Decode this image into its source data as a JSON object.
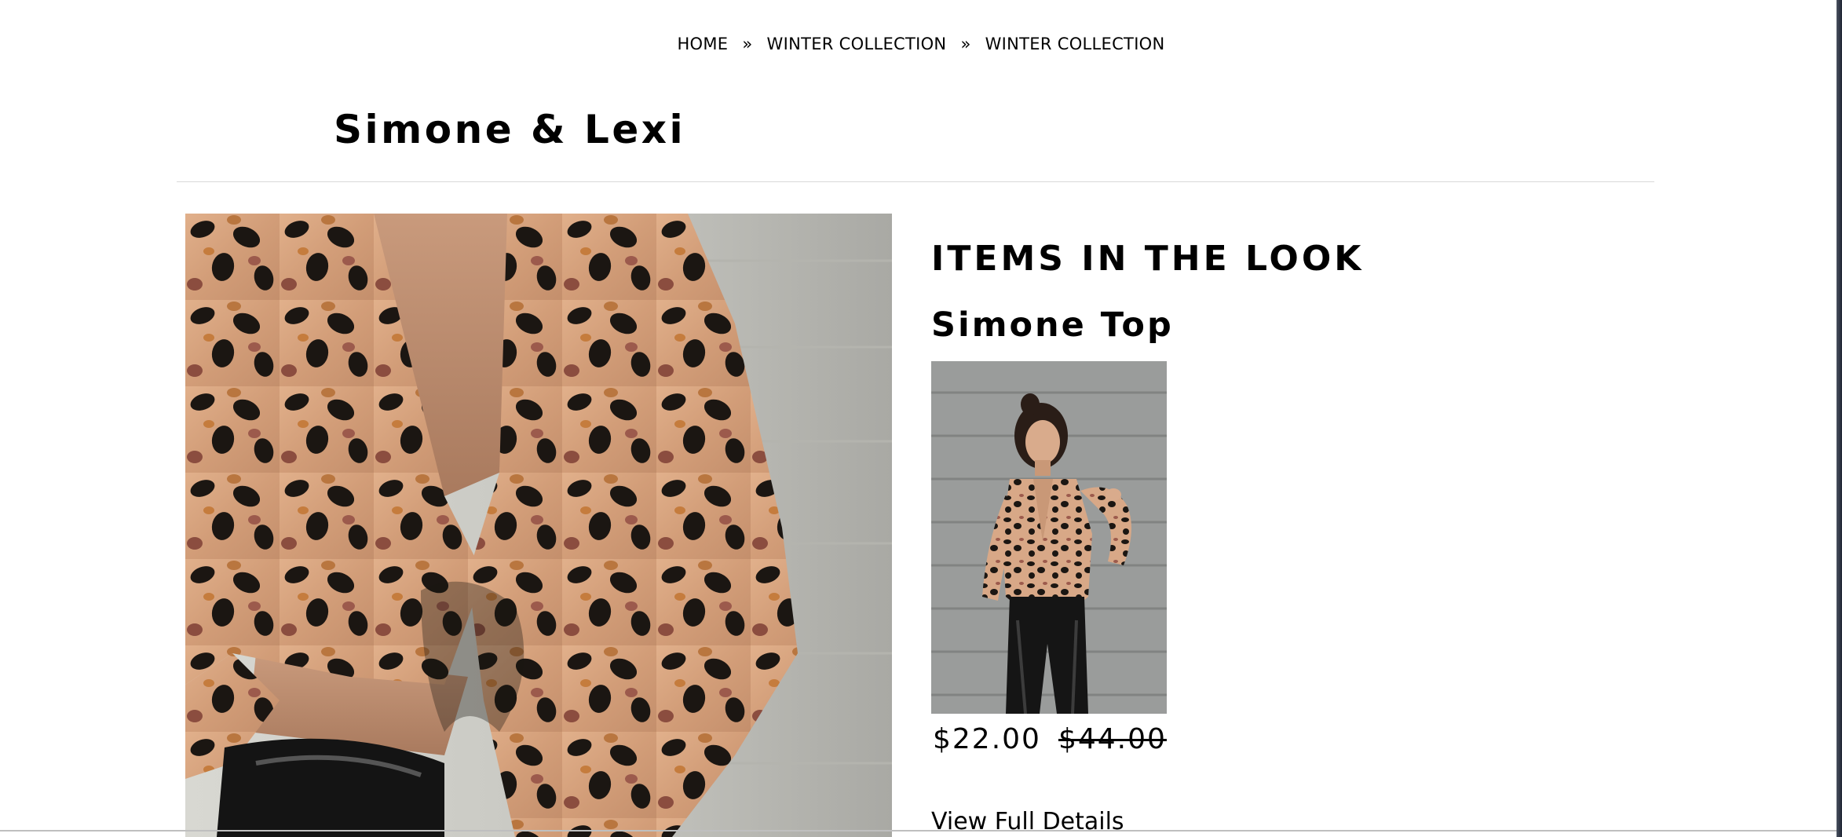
{
  "breadcrumb": {
    "items": [
      "HOME",
      "WINTER COLLECTION",
      "WINTER COLLECTION"
    ],
    "separator": "»"
  },
  "page": {
    "title": "Simone & Lexi"
  },
  "look": {
    "image_icon": "leopard-print-top-photo"
  },
  "items_section": {
    "heading": "ITEMS IN THE LOOK",
    "products": [
      {
        "name": "Simone Top",
        "sale_price": "$22.00",
        "original_price": "$44.00",
        "details_label": "View Full Details",
        "image_icon": "model-photo"
      }
    ]
  },
  "colors": {
    "text": "#000000",
    "leopard_base": "#d6a37e",
    "leopard_spot": "#1b1612",
    "wall": "#b9b9b4"
  }
}
